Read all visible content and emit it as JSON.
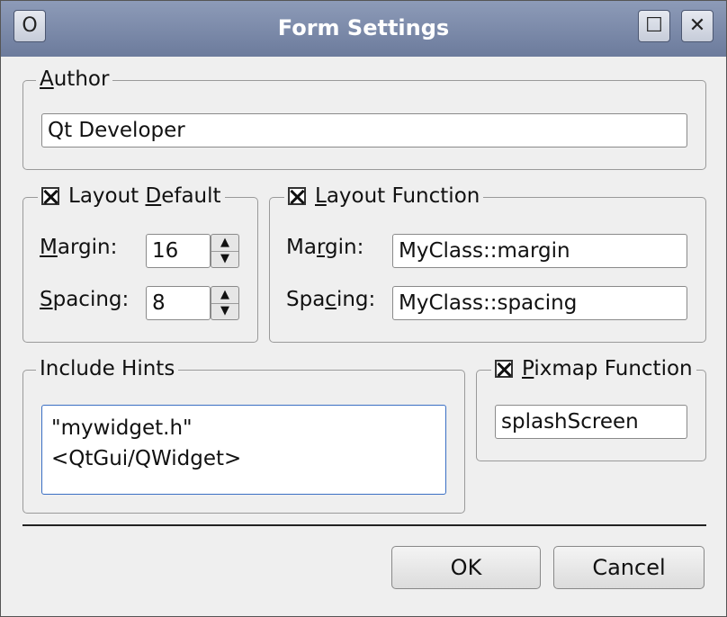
{
  "window": {
    "title": "Form Settings",
    "system_button": "O",
    "maximize_button": "☐",
    "close_button": "✕"
  },
  "author": {
    "label_u": "A",
    "label_rest": "uthor",
    "value": "Qt Developer"
  },
  "layout_default": {
    "checked": true,
    "label_a": "Layout ",
    "label_u": "D",
    "label_b": "efault",
    "margin_u": "M",
    "margin_rest": "argin:",
    "margin_value": "16",
    "spacing_u": "S",
    "spacing_rest": "pacing:",
    "spacing_value": "8",
    "spin_up": "▲",
    "spin_down": "▼"
  },
  "layout_function": {
    "checked": true,
    "label_u": "L",
    "label_rest": "ayout Function",
    "margin_a": "Ma",
    "margin_u": "r",
    "margin_b": "gin:",
    "margin_value": "MyClass::margin",
    "spacing_a": "Spa",
    "spacing_u": "c",
    "spacing_b": "ing:",
    "spacing_value": "MyClass::spacing"
  },
  "include_hints": {
    "label": "Include Hints",
    "lines": [
      "\"mywidget.h\"",
      "<QtGui/QWidget>"
    ]
  },
  "pixmap_function": {
    "checked": true,
    "label_u": "P",
    "label_rest": "ixmap Function",
    "value": "splashScreen"
  },
  "buttons": {
    "ok": "OK",
    "cancel": "Cancel"
  }
}
